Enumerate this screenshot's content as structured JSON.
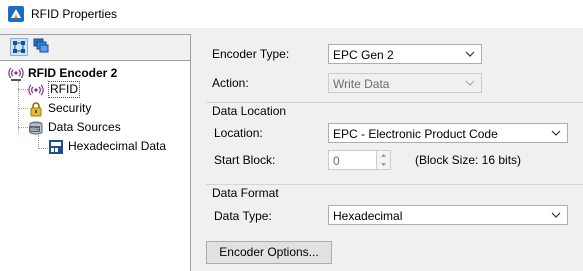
{
  "window": {
    "title": "RFID Properties"
  },
  "tree": {
    "root": "RFID Encoder 2",
    "items": [
      "RFID",
      "Security",
      "Data Sources",
      "Hexadecimal Data"
    ]
  },
  "form": {
    "encoder_type": {
      "label": "Encoder Type:",
      "value": "EPC Gen 2"
    },
    "action": {
      "label": "Action:",
      "value": "Write Data"
    },
    "data_location": {
      "title": "Data Location",
      "location_label": "Location:",
      "location_value": "EPC - Electronic Product Code",
      "start_block_label": "Start Block:",
      "start_block_value": "0",
      "block_size": "(Block Size: 16 bits)"
    },
    "data_format": {
      "title": "Data Format",
      "data_type_label": "Data Type:",
      "data_type_value": "Hexadecimal"
    },
    "encoder_options_button": "Encoder Options..."
  },
  "colors": {
    "accent_blue": "#1a6fc4",
    "rfid_purple": "#8b2a8b"
  }
}
